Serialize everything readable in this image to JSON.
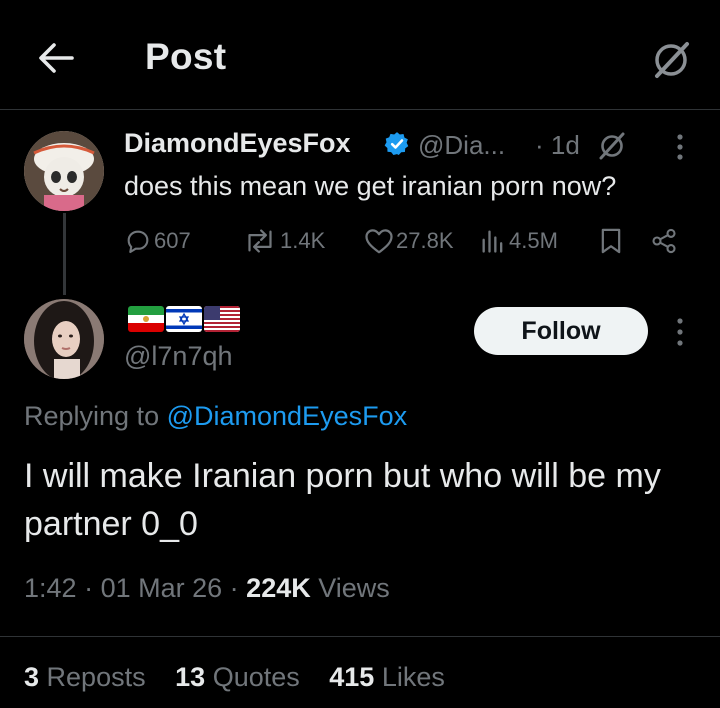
{
  "header": {
    "title": "Post",
    "back_icon": "arrow-left-icon",
    "grok_icon": "grok-icon"
  },
  "parent_post": {
    "display_name": "DiamondEyesFox",
    "handle": "@Dia...",
    "time": "· 1d",
    "text": "does this mean we get iranian porn now?",
    "verified": true,
    "stats": {
      "replies": "607",
      "reposts": "1.4K",
      "likes": "27.8K",
      "views": "4.5M"
    }
  },
  "reply_post": {
    "flags": [
      "iran-lion-and-sun-flag",
      "israel-flag",
      "usa-flag"
    ],
    "handle": "@l7n7qh",
    "follow_label": "Follow",
    "replying_prefix": "Replying to ",
    "replying_mention": "@DiamondEyesFox",
    "text": "I will make Iranian porn but who will be my partner 0_0",
    "time": "1:42",
    "date": "01 Mar 26",
    "views_count": "224K",
    "views_label": " Views",
    "reposts_count": "3",
    "reposts_label": "Reposts",
    "quotes_count": "13",
    "quotes_label": "Quotes",
    "likes_count": "415",
    "likes_label": "Likes"
  },
  "colors": {
    "background": "#000000",
    "text": "#e7e9ea",
    "muted": "#71767b",
    "accent": "#1d9bf0",
    "follow_bg": "#eff3f4"
  }
}
